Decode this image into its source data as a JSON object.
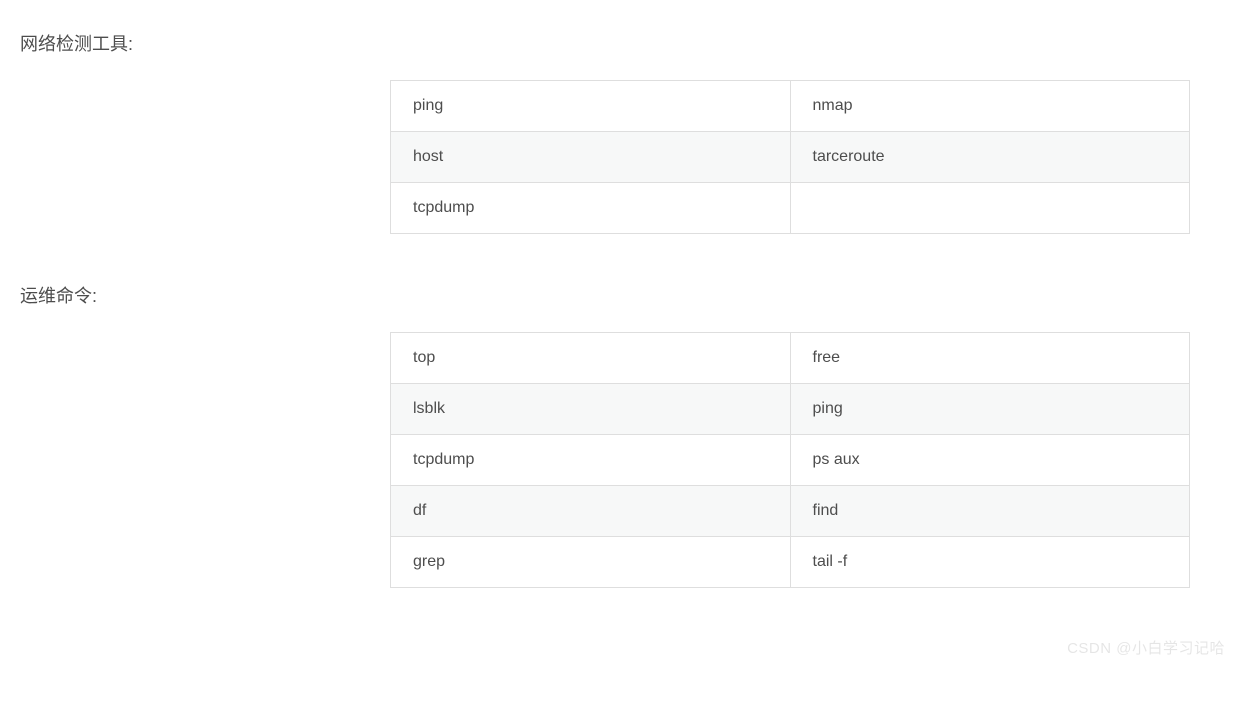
{
  "sections": [
    {
      "title": "网络检测工具:",
      "rows": [
        [
          "ping",
          "nmap"
        ],
        [
          "host",
          "tarceroute"
        ],
        [
          "tcpdump",
          ""
        ]
      ]
    },
    {
      "title": "运维命令:",
      "rows": [
        [
          "top",
          "free"
        ],
        [
          "lsblk",
          "ping"
        ],
        [
          "tcpdump",
          "ps  aux"
        ],
        [
          "df",
          "find"
        ],
        [
          "grep",
          "tail   -f"
        ]
      ]
    }
  ],
  "watermark": "CSDN @小白学习记哈"
}
